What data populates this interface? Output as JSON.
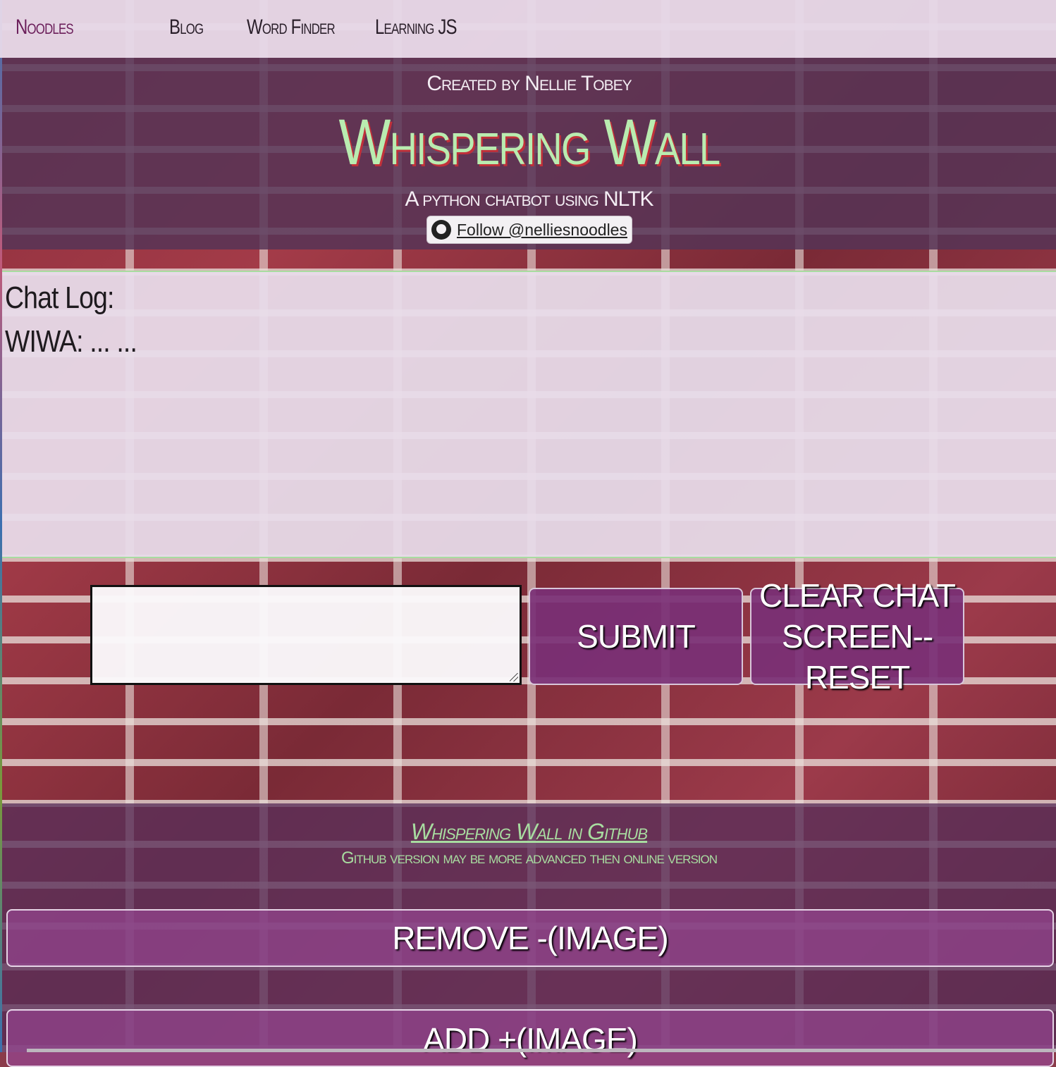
{
  "nav": {
    "brand": "Noodles",
    "items": [
      "Blog",
      "Word Finder",
      "Learning JS"
    ]
  },
  "header": {
    "created_by": "Created by Nellie Tobey",
    "title": "Whispering Wall",
    "subtitle": "A python chatbot using NLTK",
    "github_follow": "Follow @nelliesnoodles"
  },
  "chat": {
    "log_label": "Chat Log:",
    "messages": [
      "WIWA: ... ..."
    ],
    "input_value": ""
  },
  "buttons": {
    "submit": "SUBMIT",
    "clear": "CLEAR CHAT SCREEN-- RESET",
    "remove_image": "REMOVE -(IMAGE)",
    "add_image": "ADD +(IMAGE)"
  },
  "footer": {
    "github_link": "Whispering Wall in Github",
    "note": "Github version may be more advanced then online version"
  },
  "colors": {
    "accent_green": "#b9ecb0",
    "button_purple": "#7a3076",
    "nav_bg": "#e6d8e8"
  }
}
